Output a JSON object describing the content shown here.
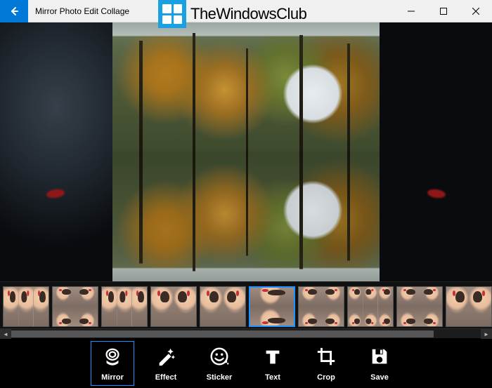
{
  "titlebar": {
    "title": "Mirror Photo Edit Collage"
  },
  "watermark": {
    "text": "TheWindowsClub"
  },
  "thumbnails": {
    "selected_index": 5,
    "items": [
      {
        "layout": "3h",
        "name": "mirror-3col"
      },
      {
        "layout": "2x2",
        "name": "mirror-2x2-a"
      },
      {
        "layout": "3h",
        "name": "mirror-3col-b"
      },
      {
        "layout": "2h",
        "name": "mirror-2col-hflip"
      },
      {
        "layout": "2h",
        "name": "mirror-2col"
      },
      {
        "layout": "2v",
        "name": "mirror-2row-vflip"
      },
      {
        "layout": "2x2",
        "name": "mirror-2x2-b"
      },
      {
        "layout": "3x2",
        "name": "mirror-3x2"
      },
      {
        "layout": "2x2",
        "name": "mirror-2x2-c"
      },
      {
        "layout": "2h",
        "name": "mirror-2col-c"
      }
    ]
  },
  "toolbar": {
    "selected_index": 0,
    "items": [
      {
        "id": "mirror",
        "label": "Mirror"
      },
      {
        "id": "effect",
        "label": "Effect"
      },
      {
        "id": "sticker",
        "label": "Sticker"
      },
      {
        "id": "text",
        "label": "Text"
      },
      {
        "id": "crop",
        "label": "Crop"
      },
      {
        "id": "save",
        "label": "Save"
      }
    ]
  }
}
